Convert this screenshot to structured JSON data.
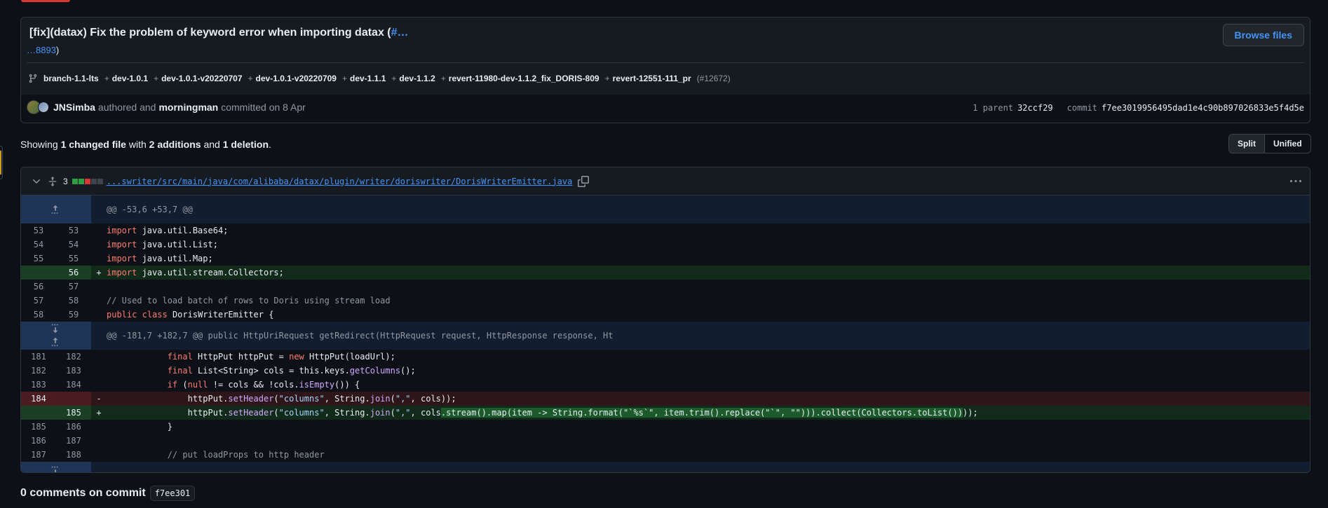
{
  "commit": {
    "title": "[fix](datax) Fix the problem of keyword error when importing datax (",
    "title_link": "#…",
    "subtitle_link": "…8893",
    "subtitle_tail": ")",
    "browse_label": "Browse files",
    "branches": [
      "branch-1.1-lts",
      "dev-1.0.1",
      "dev-1.0.1-v20220707",
      "dev-1.0.1-v20220709",
      "dev-1.1.1",
      "dev-1.1.2",
      "revert-11980-dev-1.1.2_fix_DORIS-809",
      "revert-12551-111_pr"
    ],
    "pr_ref": "(#12672)",
    "author": "JNSimba",
    "authored_text": "authored and",
    "committer": "morningman",
    "committed_text": "committed on 8 Apr",
    "parent_label": "1 parent",
    "parent_sha": "32ccf29",
    "commit_label": "commit",
    "commit_sha": "f7ee3019956495dad1e4c90b897026833e5f4d5e"
  },
  "summary": {
    "showing": "Showing",
    "changed": "1 changed file",
    "with": "with",
    "additions": "2 additions",
    "and": "and",
    "deletions": "1 deletion",
    "period": "."
  },
  "view_toggle": {
    "split": "Split",
    "unified": "Unified",
    "active": "split"
  },
  "file": {
    "change_count": "3",
    "diffstat": [
      "add",
      "add",
      "del",
      "neutral",
      "neutral"
    ],
    "path": "...swriter/src/main/java/com/alibaba/datax/plugin/writer/doriswriter/DorisWriterEmitter.java",
    "hunks": {
      "h1": "@@ -53,6 +53,7 @@",
      "h2": "@@ -181,7 +182,7 @@ public HttpUriRequest getRedirect(HttpRequest request, HttpResponse response, Ht"
    }
  },
  "comments": {
    "label": "0 comments on commit",
    "sha": "f7ee301"
  },
  "colors": {
    "add_bg": "#122a1a",
    "del_bg": "#2d1519",
    "hunk_bg": "#121d2f",
    "link": "#4493f8"
  }
}
